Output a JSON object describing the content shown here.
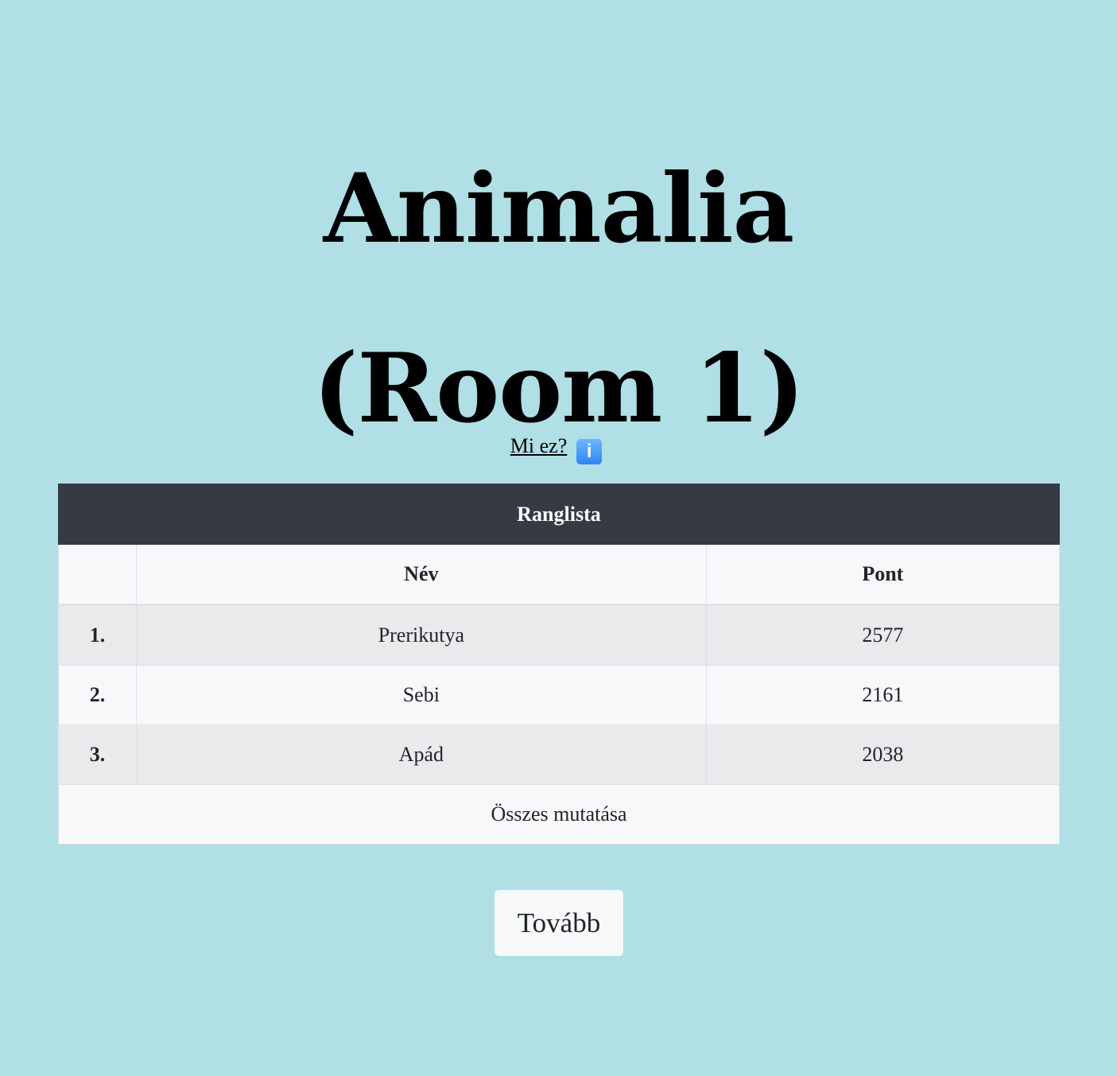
{
  "header": {
    "title_line1": "Animalia",
    "title_line2": "(Room 1)",
    "info_link_label": "Mi ez?",
    "info_icon": "info-icon",
    "info_icon_glyph": "i"
  },
  "leaderboard": {
    "caption": "Ranglista",
    "columns": [
      "",
      "Név",
      "Pont"
    ],
    "rows": [
      {
        "rank": "1.",
        "name": "Prerikutya",
        "score": "2577"
      },
      {
        "rank": "2.",
        "name": "Sebi",
        "score": "2161"
      },
      {
        "rank": "3.",
        "name": "Apád",
        "score": "2038"
      }
    ],
    "show_all_label": "Összes mutatása"
  },
  "actions": {
    "next_label": "Tovább"
  },
  "colors": {
    "background": "#b0dfe5",
    "table_header": "#363a44",
    "button_bg": "#f7f8fa"
  }
}
